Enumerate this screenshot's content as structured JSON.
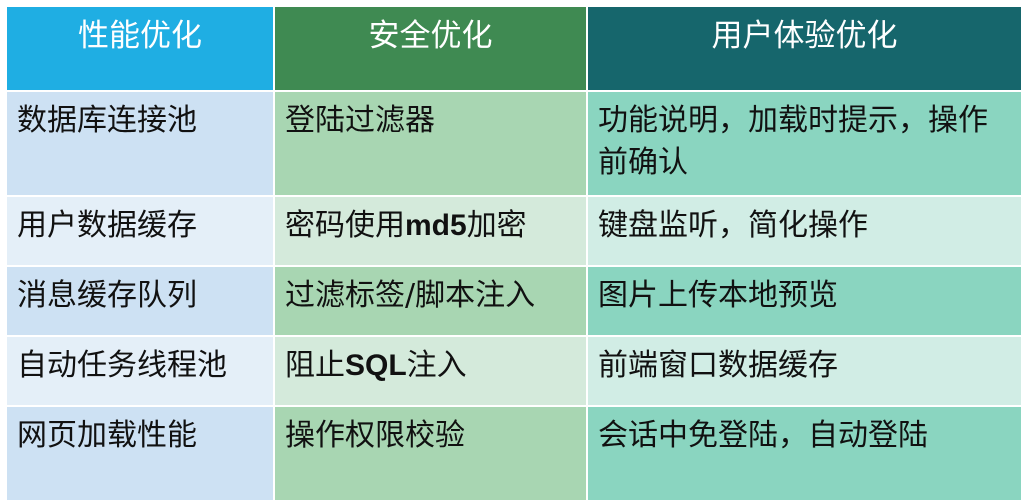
{
  "colors": {
    "header": [
      "#1faee3",
      "#3f8a52",
      "#16666c"
    ]
  },
  "headers": [
    "性能优化",
    "安全优化",
    "用户体验优化"
  ],
  "rows": [
    {
      "perf": "数据库连接池",
      "sec": "登陆过滤器",
      "ux": "功能说明，加载时提示，操作前确认"
    },
    {
      "perf": "用户数据缓存",
      "sec_pre": "密码使用",
      "sec_bold": "md5",
      "sec_post": "加密",
      "ux": "键盘监听，简化操作"
    },
    {
      "perf": "消息缓存队列",
      "sec": "过滤标签/脚本注入",
      "ux": "图片上传本地预览"
    },
    {
      "perf": "自动任务线程池",
      "sec_pre": "阻止",
      "sec_bold": "SQL",
      "sec_post": "注入",
      "ux": "前端窗口数据缓存"
    },
    {
      "perf": "网页加载性能",
      "sec": "操作权限校验",
      "ux": "会话中免登陆，自动登陆"
    }
  ]
}
